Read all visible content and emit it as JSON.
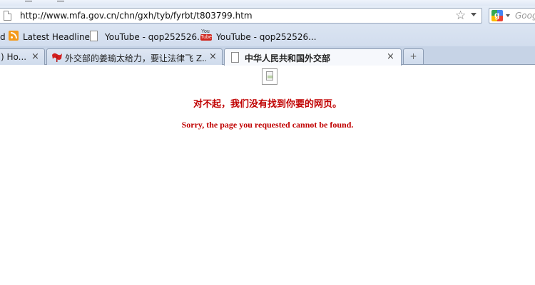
{
  "browser": {
    "url": "http://www.mfa.gov.cn/chn/gxh/tyb/fyrbt/t803799.htm",
    "search_placeholder": "Goog",
    "search_engine_icon": "google-icon",
    "star_icon": "star-icon"
  },
  "bookmarks": [
    {
      "label": "d",
      "icon": ""
    },
    {
      "label": "Latest Headlines",
      "icon": "rss-icon"
    },
    {
      "label": "YouTube - qop252526...",
      "icon": "page-icon"
    },
    {
      "label": "YouTube - qop252526...",
      "icon": "youtube-icon"
    }
  ],
  "youtube_logo": {
    "top": "You",
    "bottom": "Tube"
  },
  "tabs": [
    {
      "label": ") Ho...",
      "close": "×",
      "active": false
    },
    {
      "label": "外交部的姜瑜太给力，要让法律飞 Z...",
      "close": "×",
      "active": false,
      "icon": "red-flag-icon"
    },
    {
      "label": "中华人民共和国外交部",
      "close": "×",
      "active": true,
      "icon": "page-icon"
    }
  ],
  "new_tab_label": "+",
  "page": {
    "error_cn": "对不起，我们没有找到你要的网页。",
    "error_en": "Sorry, the page you requested cannot be found.",
    "text_color": "#c00000"
  }
}
